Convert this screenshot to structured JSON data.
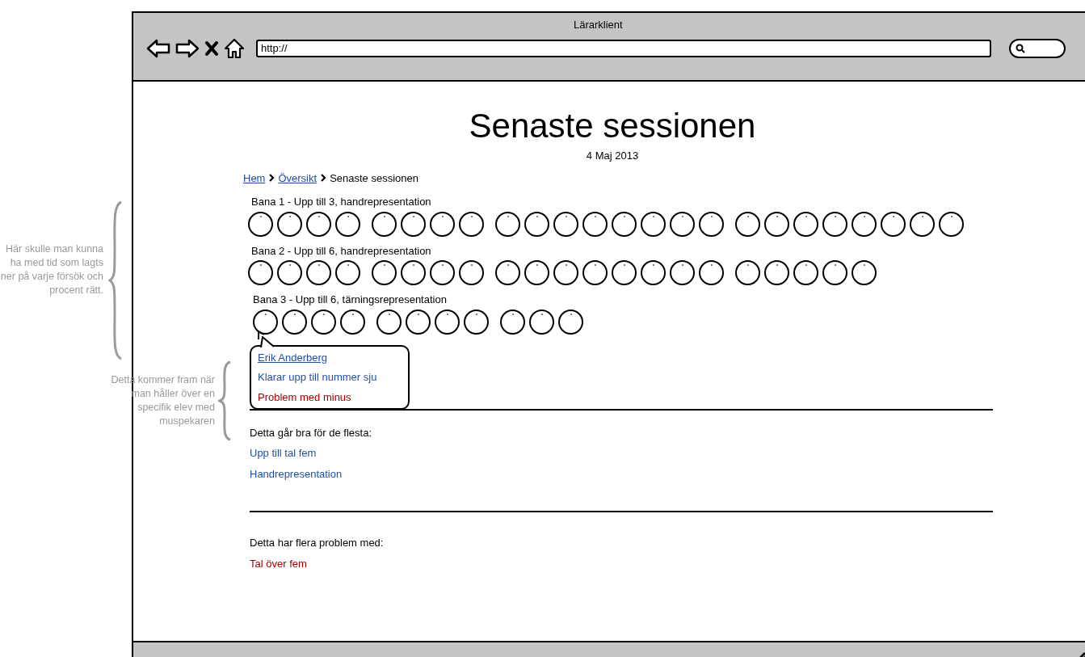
{
  "window": {
    "title": "Lärarklient",
    "address": "http://"
  },
  "annotations": [
    {
      "text": "Här skulle man kunna ha med tid som lagts ner på varje försök och procent rätt."
    },
    {
      "text": "Detta kommer fram när man håller över en specifik elev med muspekaren"
    }
  ],
  "page": {
    "title": "Senaste sessionen",
    "date": "4 Maj 2013",
    "breadcrumb": [
      {
        "label": "Hem",
        "kind": "link"
      },
      {
        "label": "Översikt",
        "kind": "link"
      },
      {
        "label": "Senaste sessionen",
        "kind": "current"
      }
    ],
    "tracks": [
      {
        "label": "Bana 1 - Upp till 3, handrepresentation",
        "groups": [
          [
            {
              "hovered": false
            },
            {
              "hovered": false
            },
            {
              "hovered": false
            },
            {
              "hovered": false
            }
          ],
          [
            {
              "hovered": false
            },
            {
              "hovered": false
            },
            {
              "hovered": false
            },
            {
              "hovered": false
            }
          ],
          [
            {
              "hovered": false
            },
            {
              "hovered": false
            },
            {
              "hovered": false
            },
            {
              "hovered": false
            },
            {
              "hovered": false
            },
            {
              "hovered": false
            },
            {
              "hovered": false
            },
            {
              "hovered": false
            }
          ],
          [
            {
              "hovered": false
            },
            {
              "hovered": false
            },
            {
              "hovered": false
            },
            {
              "hovered": false
            },
            {
              "hovered": false
            },
            {
              "hovered": false
            },
            {
              "hovered": false
            },
            {
              "hovered": false
            }
          ]
        ]
      },
      {
        "label": "Bana 2 - Upp till 6, handrepresentation",
        "groups": [
          [
            {
              "hovered": false
            },
            {
              "hovered": false
            },
            {
              "hovered": false
            },
            {
              "hovered": false
            }
          ],
          [
            {
              "hovered": false
            },
            {
              "hovered": false
            },
            {
              "hovered": false
            },
            {
              "hovered": false
            }
          ],
          [
            {
              "hovered": false
            },
            {
              "hovered": false
            },
            {
              "hovered": false
            },
            {
              "hovered": false
            },
            {
              "hovered": false
            },
            {
              "hovered": false
            },
            {
              "hovered": false
            },
            {
              "hovered": false
            }
          ],
          [
            {
              "hovered": false
            },
            {
              "hovered": false
            },
            {
              "hovered": false
            },
            {
              "hovered": false
            },
            {
              "hovered": false
            }
          ]
        ]
      },
      {
        "label": "Bana 3 - Upp till 6, tärningsrepresentation",
        "groups": [
          [
            {
              "hovered": true
            },
            {
              "hovered": false
            },
            {
              "hovered": false
            },
            {
              "hovered": false
            }
          ],
          [
            {
              "hovered": false
            },
            {
              "hovered": false
            },
            {
              "hovered": false
            },
            {
              "hovered": false
            }
          ],
          [
            {
              "hovered": false
            },
            {
              "hovered": false
            },
            {
              "hovered": false
            }
          ]
        ]
      }
    ],
    "tooltip": {
      "name": "Erik Anderberg",
      "lines": [
        {
          "text": "Klarar upp till nummer sju",
          "kind": "good"
        },
        {
          "text": "Problem med minus",
          "kind": "problem"
        }
      ]
    },
    "sections": [
      {
        "heading": "Detta går bra för de flesta:",
        "items": [
          {
            "text": "Upp till tal fem",
            "kind": "good"
          },
          {
            "text": "Handrepresentation",
            "kind": "good"
          }
        ]
      },
      {
        "heading": "Detta har flera problem med:",
        "items": [
          {
            "text": "Tal över fem",
            "kind": "problem"
          }
        ]
      }
    ]
  }
}
